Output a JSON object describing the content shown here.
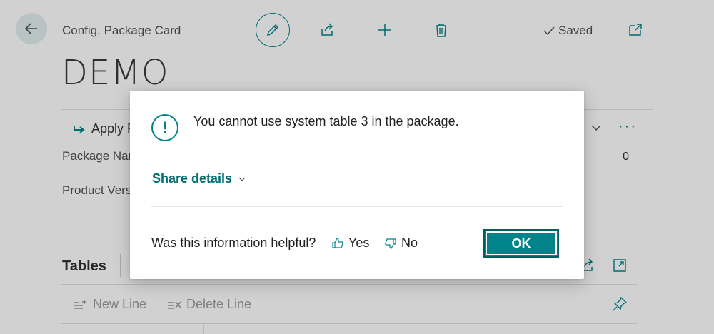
{
  "header": {
    "caption": "Config. Package Card",
    "saved_label": "Saved",
    "record_title": "DEMO",
    "icons": [
      "back-arrow-icon",
      "pencil-icon",
      "share-icon",
      "plus-icon",
      "trash-icon",
      "checkmark-icon",
      "open-new-window-icon"
    ]
  },
  "action_bar": {
    "apply_label": "Apply P",
    "more_label": "···"
  },
  "fields": {
    "package_name_label": "Package Nar",
    "product_version_label": "Product Vers",
    "count_value": "0"
  },
  "tables": {
    "title": "Tables",
    "new_line_label": "New Line",
    "delete_line_label": "Delete Line"
  },
  "dialog": {
    "icon_glyph": "!",
    "message": "You cannot use system table 3 in the package.",
    "share_details_label": "Share details",
    "helpful_question": "Was this information helpful?",
    "yes_label": "Yes",
    "no_label": "No",
    "ok_label": "OK"
  },
  "colors": {
    "accent": "#008489",
    "accent_dark": "#006b70",
    "ok_button": "#00838a"
  }
}
